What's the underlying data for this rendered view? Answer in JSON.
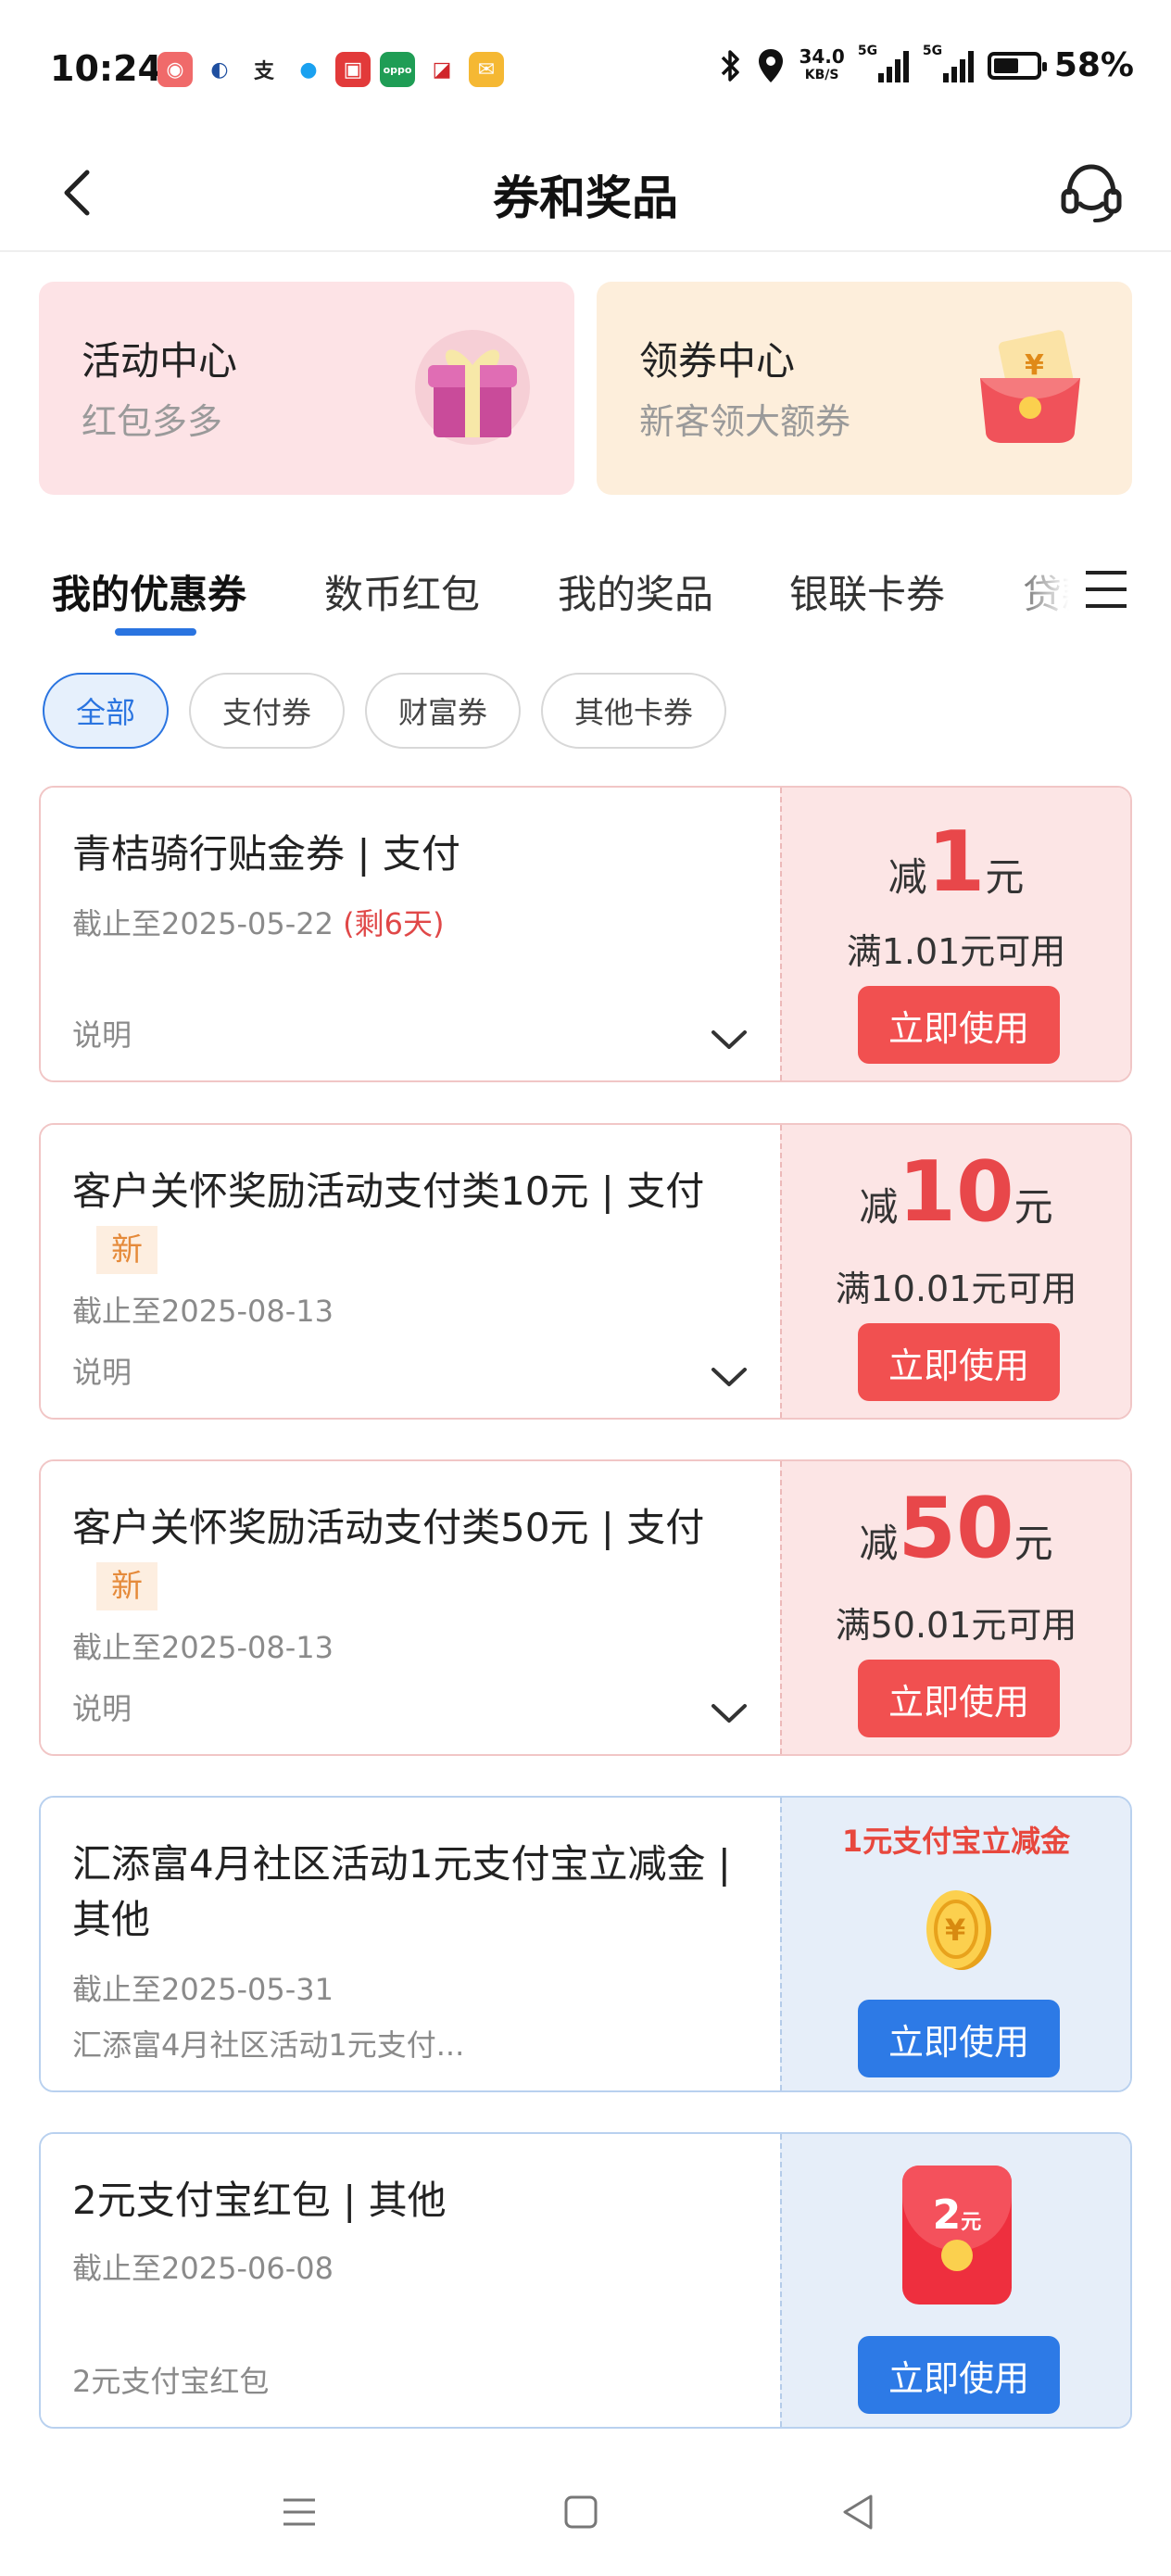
{
  "status_bar": {
    "time": "10:24",
    "net_speed_value": "34.0",
    "net_speed_unit": "KB/S",
    "network_1": "5G",
    "network_2": "5G",
    "battery": "58%",
    "battery_level": 0.58
  },
  "header": {
    "title": "券和奖品"
  },
  "promos": [
    {
      "title": "活动中心",
      "subtitle": "红包多多"
    },
    {
      "title": "领券中心",
      "subtitle": "新客领大额券"
    }
  ],
  "tabs": [
    {
      "label": "我的优惠券"
    },
    {
      "label": "数币红包"
    },
    {
      "label": "我的奖品"
    },
    {
      "label": "银联卡券"
    },
    {
      "label": "贷款"
    }
  ],
  "filters": [
    {
      "label": "全部"
    },
    {
      "label": "支付券"
    },
    {
      "label": "财富券"
    },
    {
      "label": "其他卡券"
    }
  ],
  "coupons": [
    {
      "title": "青桔骑行贴金券 | 支付",
      "expire": "截止至2025-05-22",
      "remain": "(剩6天)",
      "desc": "说明",
      "prefix": "减",
      "amount": "1",
      "unit": "元",
      "condition": "满1.01元可用",
      "button": "立即使用"
    },
    {
      "title": "客户关怀奖励活动支付类10元 | 支付",
      "badge": "新",
      "expire": "截止至2025-08-13",
      "desc": "说明",
      "prefix": "减",
      "amount": "10",
      "unit": "元",
      "condition": "满10.01元可用",
      "button": "立即使用"
    },
    {
      "title": "客户关怀奖励活动支付类50元 | 支付",
      "badge": "新",
      "expire": "截止至2025-08-13",
      "desc": "说明",
      "prefix": "减",
      "amount": "50",
      "unit": "元",
      "condition": "满50.01元可用",
      "button": "立即使用"
    },
    {
      "title": "汇添富4月社区活动1元支付宝立减金 | 其他",
      "expire": "截止至2025-05-31",
      "desc": "汇添富4月社区活动1元支付...",
      "promo_text": "1元支付宝立减金",
      "button": "立即使用"
    },
    {
      "title": "2元支付宝红包 | 其他",
      "expire": "截止至2025-06-08",
      "desc": "2元支付宝红包",
      "envelope_text": "2",
      "envelope_unit": "元",
      "button": "立即使用"
    }
  ],
  "colors": {
    "accent_blue": "#2a74e0",
    "accent_red": "#f15050"
  }
}
